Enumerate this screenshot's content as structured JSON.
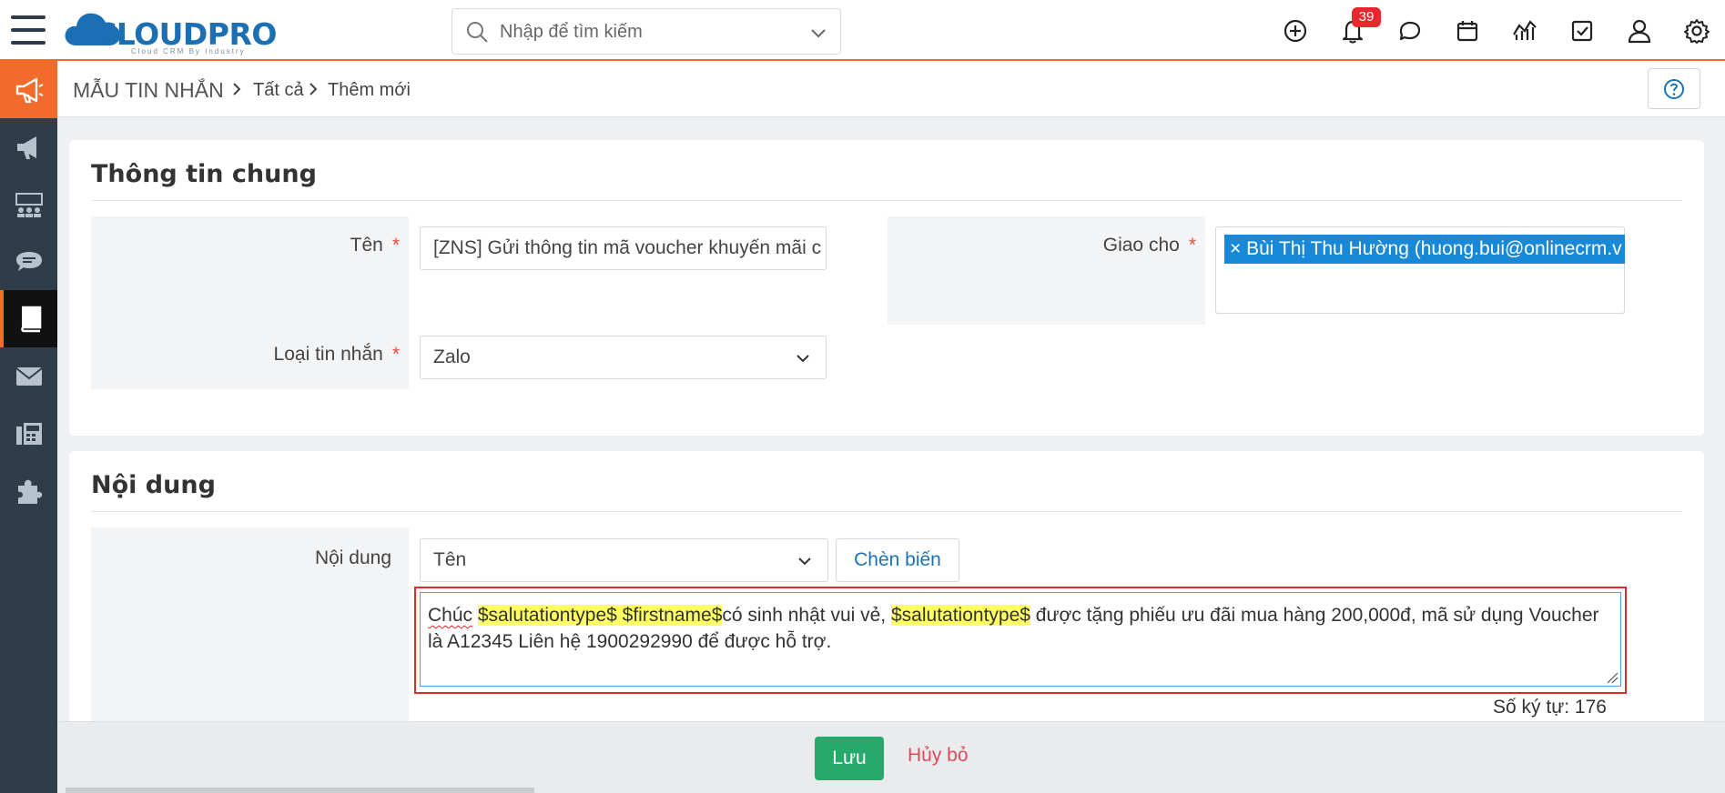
{
  "header": {
    "logo_text": "CLOUDPRO",
    "logo_sub": "Cloud CRM By Industry",
    "search_placeholder": "Nhập để tìm kiếm",
    "notification_count": "39"
  },
  "breadcrumb": {
    "module": "MẪU TIN NHẮN",
    "items": [
      "Tất cả",
      "Thêm mới"
    ]
  },
  "general": {
    "title": "Thông tin chung",
    "name_label": "Tên",
    "name_value": "[ZNS] Gửi thông tin mã voucher khuyến mãi c",
    "type_label": "Loại tin nhắn",
    "type_value": "Zalo",
    "assign_label": "Giao cho",
    "assign_tag": "× Bùi Thị Thu Hường (huong.bui@onlinecrm.v"
  },
  "content": {
    "title": "Nội dung",
    "label": "Nội dung",
    "variable_select": "Tên",
    "insert_button": "Chèn biến",
    "text_parts": {
      "p1": "Chúc",
      "v1": "$salutationtype$ $firstname$",
      "p2": "có sinh nhật vui vẻ,",
      "v2": "$salutationtype$",
      "p3": "được tặng phiếu ưu đãi mua hàng 200,000đ, mã sử dụng Voucher là A12345 Liên hệ 1900292990 để được hỗ trợ."
    },
    "char_count": "Số ký tự: 176"
  },
  "footer": {
    "save": "Lưu",
    "cancel": "Hủy bỏ"
  },
  "colors": {
    "accent": "#f26b2a",
    "primary": "#1888d9",
    "save": "#27a96b",
    "danger": "#e02a2a"
  }
}
